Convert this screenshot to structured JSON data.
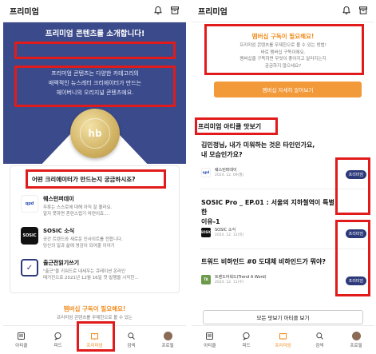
{
  "app_title": "프리미엄",
  "left": {
    "hero": {
      "title": "프리미엄 콘텐츠를 소개합니다!",
      "sub1": "프리미엄 콘텐츠는 다양한 카테고리의",
      "sub2": "매력적인 뉴스레터 크리에이터가 만드는",
      "sub3": "헤이버니의 오리지널 콘텐츠에요.",
      "seal_text": "hb"
    },
    "question": "어떤 크리에이터가 만드는지 궁금하시죠?",
    "creators": [
      {
        "logo": "qpd",
        "name": "웨스턴퍼데이",
        "desc1": "무릇는 스스로에 대해 아직 잘 몰라요.",
        "desc2": "알지 못하면 혼란스럽기 마련이죠...."
      },
      {
        "logo": "SOSIC",
        "name": "SOSIC 소식",
        "desc1": "공간 트렌드와 새로운 인사이트를 전합니다.",
        "desc2": "당신의 일과 삶에 영감이 되어줄 이야기"
      },
      {
        "logo": "✓",
        "name": "출근전읽기쓰기",
        "desc1": "\"출근\"을 키워드로 내세우는 큐레이션 온라인",
        "desc2": "매거진으로 2021년 12월 16일 첫 발행을 시작한..."
      }
    ],
    "membership_title": "멤버십 구독이 필요해요!",
    "membership_sub": "프리미엄 콘텐츠를 무제한으로 볼 수 있는"
  },
  "right": {
    "membership_title": "멤버십 구독이 필요해요!",
    "membership_sub1": "프리미엄 콘텐츠를 무제한으로 볼 수 있는 방법!",
    "membership_sub2": "바로 멤버십 구독이에요.",
    "membership_sub3": "멤버십을 구독하면 무엇이 좋아지고 달라지는지",
    "membership_sub4": "궁금하지 않으세요?",
    "cta": "멤버십 자세히 알아보기",
    "section_title": "프리미엄 아티클 맛보기",
    "articles": [
      {
        "title1": "김민정님, 내가 미워하는 것은 타인인가요,",
        "title2": "내 모습인가요?",
        "source": "웨스턴퍼데이",
        "date": "2024. 12. 09(월)",
        "badge": "프리미엄",
        "logo": "qpd"
      },
      {
        "title1": "SOSIC Pro _ EP.01 : 서울의 지하철역이 특별한",
        "title2": "이유-1",
        "source": "SOSIC 소식",
        "date": "2024. 12. 12(목)",
        "badge": "프리미엄",
        "logo": "SOSIC"
      },
      {
        "title1": "트워드 비하인드 #0 도대체 비하인드가 뭐야?",
        "title2": "",
        "source": "트렌드어워드(Trend A Word)",
        "date": "2024. 12. 11(수)",
        "badge": "프리미엄",
        "logo": "TA"
      }
    ],
    "more_button": "모든 맛보기 아티클 보기"
  },
  "nav": [
    "아티클",
    "피드",
    "프리미엄",
    "검색",
    "프로필"
  ],
  "colors": {
    "accent": "#f08b1c",
    "navy": "#3b4a8a",
    "badge": "#2d3a7a",
    "highlight": "#e11b1b"
  }
}
